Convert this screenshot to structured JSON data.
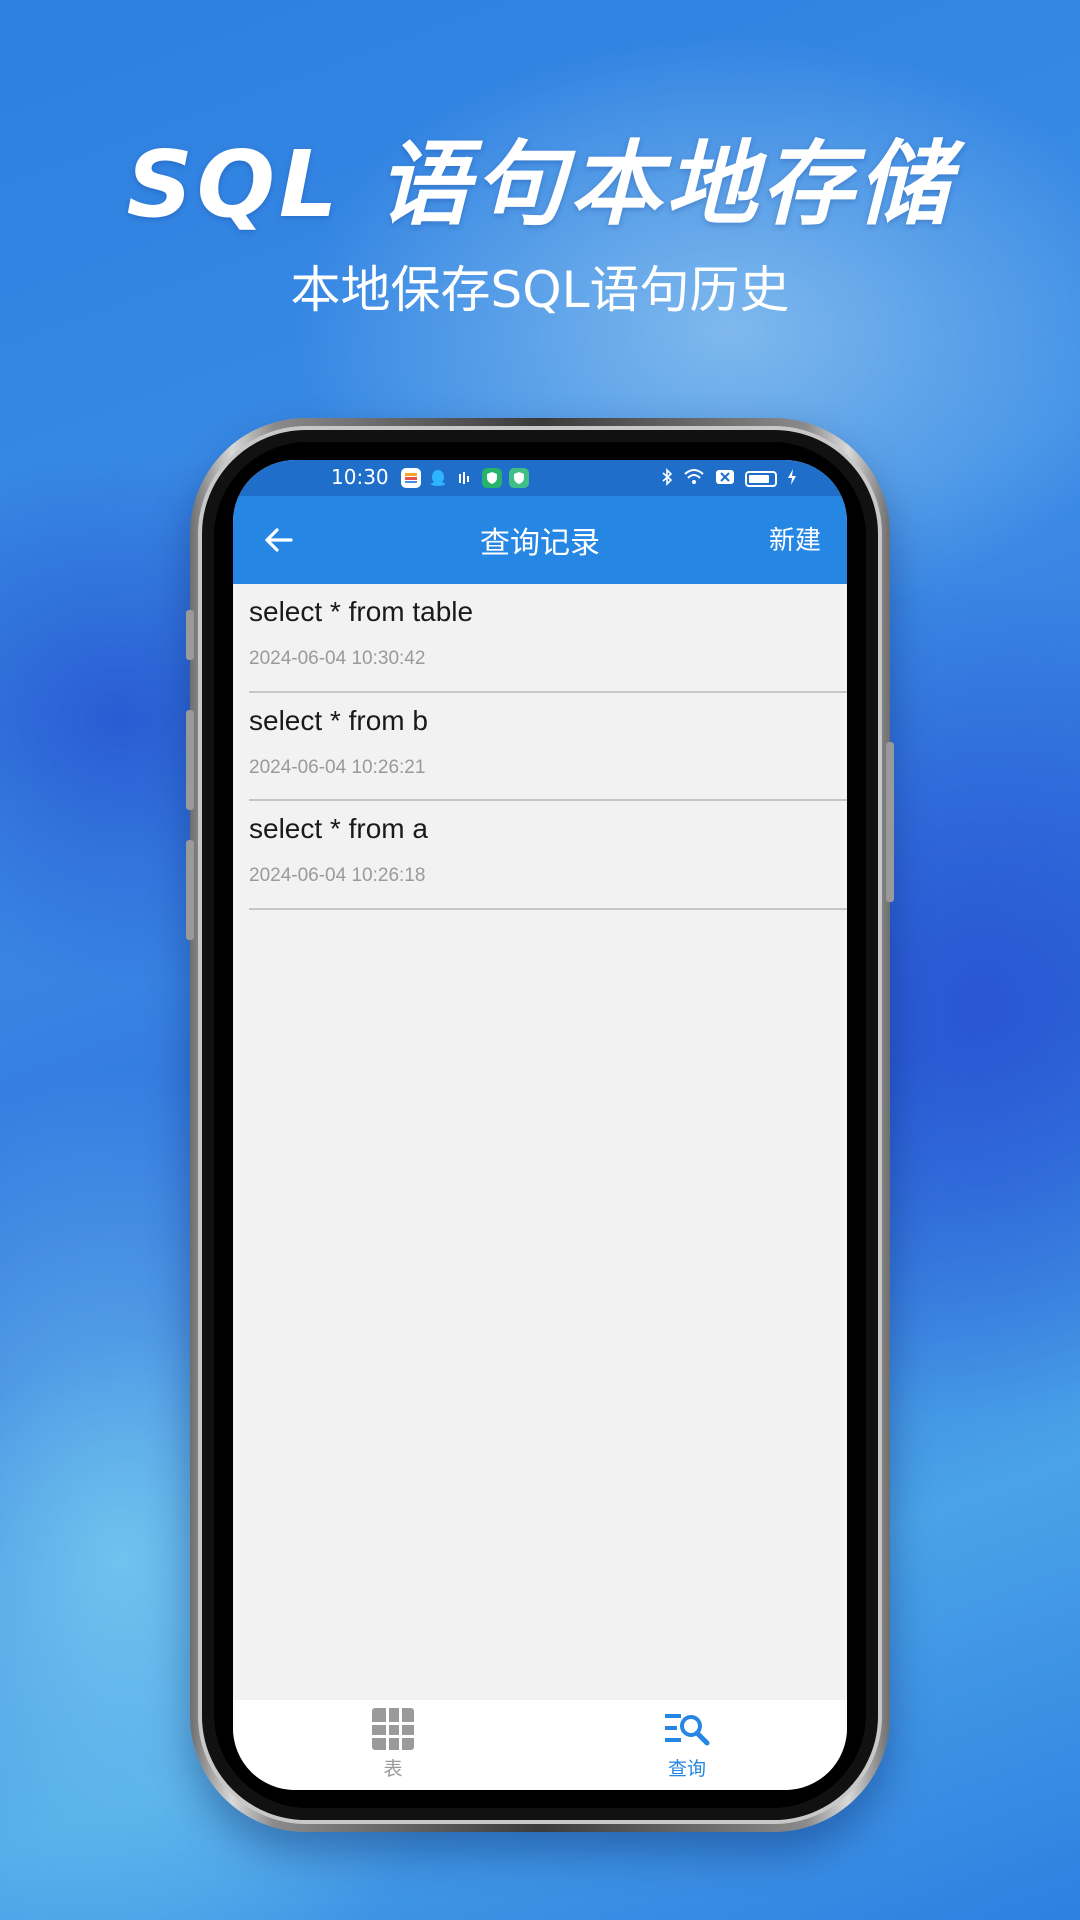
{
  "hero": {
    "headline": "SQL 语句本地存储",
    "subline": "本地保存SQL语句历史"
  },
  "status_bar": {
    "time": "10:30",
    "left_icons": [
      "chat-app-icon",
      "qq-icon",
      "signal-wave-icon",
      "shield-icon",
      "shield-icon"
    ],
    "right_icons": [
      "bluetooth-icon",
      "wifi-icon",
      "sim-off-icon",
      "battery-icon",
      "charging-icon"
    ]
  },
  "app_bar": {
    "title": "查询记录",
    "action_label": "新建",
    "back_icon": "arrow-left-icon"
  },
  "history": [
    {
      "sql": "select * from table",
      "time": "2024-06-04 10:30:42"
    },
    {
      "sql": "select * from b",
      "time": "2024-06-04 10:26:21"
    },
    {
      "sql": "select * from a",
      "time": "2024-06-04 10:26:18"
    }
  ],
  "bottom_nav": {
    "tabs": [
      {
        "label": "表",
        "icon": "table-grid-icon",
        "active": false
      },
      {
        "label": "查询",
        "icon": "query-search-icon",
        "active": true
      }
    ]
  },
  "colors": {
    "app_bar": "#2686e3",
    "status_bar": "#1f6fca",
    "active_tab": "#2686e3",
    "inactive_tab": "#9a9a9a",
    "list_background": "#f2f2f2"
  }
}
